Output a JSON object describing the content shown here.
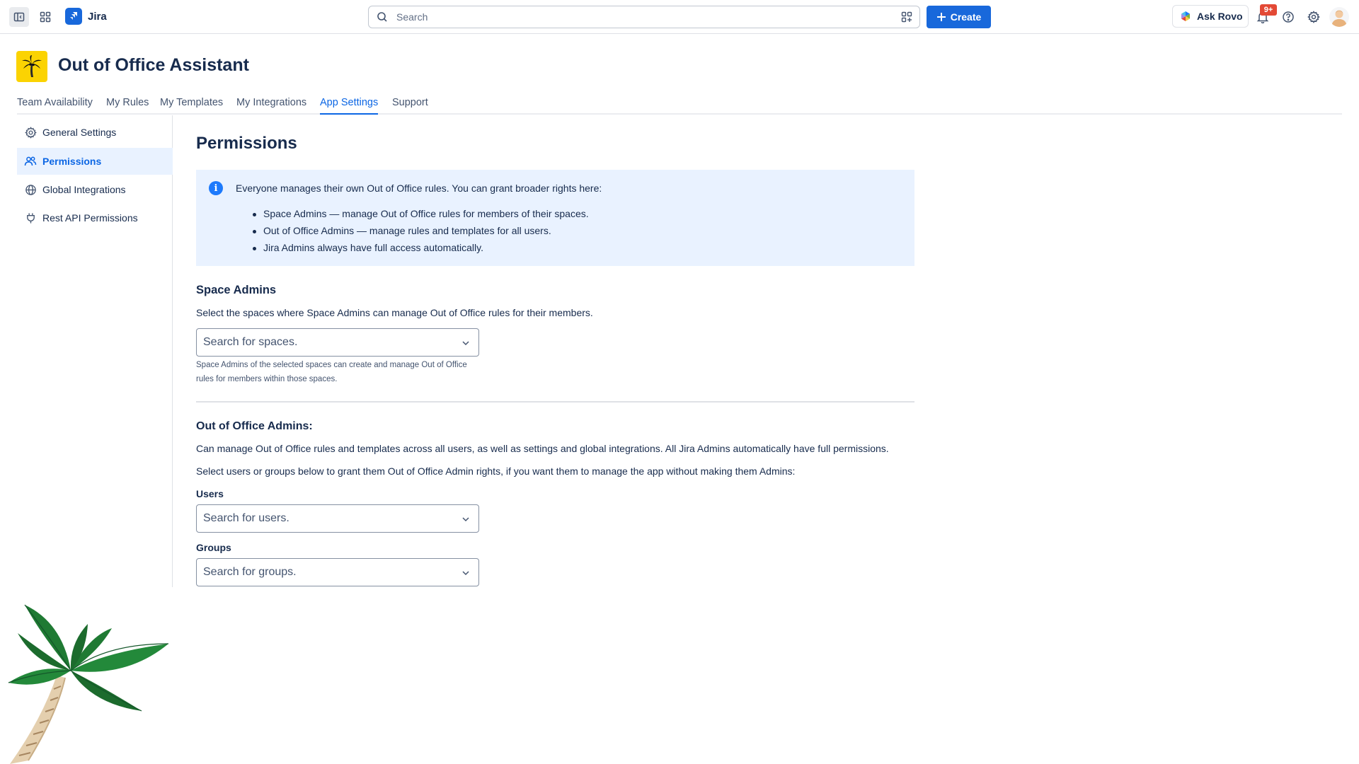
{
  "topnav": {
    "product_name": "Jira",
    "search_placeholder": "Search",
    "create_label": "Create",
    "ask_rovo_label": "Ask Rovo",
    "notification_badge": "9+",
    "icons": [
      "sidebar-toggle-icon",
      "app-switcher-icon",
      "search-icon",
      "rovo-search-icon",
      "plus-icon",
      "bell-icon",
      "help-icon",
      "gear-icon"
    ],
    "brand_color": "#1868db"
  },
  "app": {
    "title": "Out of Office Assistant",
    "logo_icon": "palm-tree-icon",
    "logo_color": "#fbd302"
  },
  "tabs": [
    {
      "label": "Team Availability",
      "active": false
    },
    {
      "label": "My Rules",
      "active": false
    },
    {
      "label": "My Templates",
      "active": false
    },
    {
      "label": "My Integrations",
      "active": false
    },
    {
      "label": "App Settings",
      "active": true
    },
    {
      "label": "Support",
      "active": false
    }
  ],
  "sidebar": {
    "items": [
      {
        "label": "General Settings",
        "icon": "gear-icon",
        "active": false
      },
      {
        "label": "Permissions",
        "icon": "people-icon",
        "active": true
      },
      {
        "label": "Global Integrations",
        "icon": "globe-icon",
        "active": false
      },
      {
        "label": "Rest API Permissions",
        "icon": "plug-icon",
        "active": false
      }
    ]
  },
  "main": {
    "title": "Permissions",
    "info": {
      "intro": "Everyone manages their own Out of Office rules. You can grant broader rights here:",
      "bullets": [
        "Space Admins — manage Out of Office rules for members of their spaces.",
        "Out of Office Admins — manage rules and templates for all users.",
        "Jira Admins always have full access automatically."
      ]
    },
    "space_admins": {
      "heading": "Space Admins",
      "description": "Select the spaces where Space Admins can manage Out of Office rules for their members.",
      "select_placeholder": "Search for spaces.",
      "help_text": "Space Admins of the selected spaces can create and manage Out of Office rules for members within those spaces."
    },
    "ooo_admins": {
      "heading": "Out of Office Admins:",
      "description": "Can manage Out of Office rules and templates across all users, as well as settings and global integrations. All Jira Admins automatically have full permissions.",
      "instruction": "Select users or groups below to grant them Out of Office Admin rights, if you want them to manage the app without making them Admins:",
      "users_label": "Users",
      "users_placeholder": "Search for users.",
      "groups_label": "Groups",
      "groups_placeholder": "Search for groups."
    }
  }
}
